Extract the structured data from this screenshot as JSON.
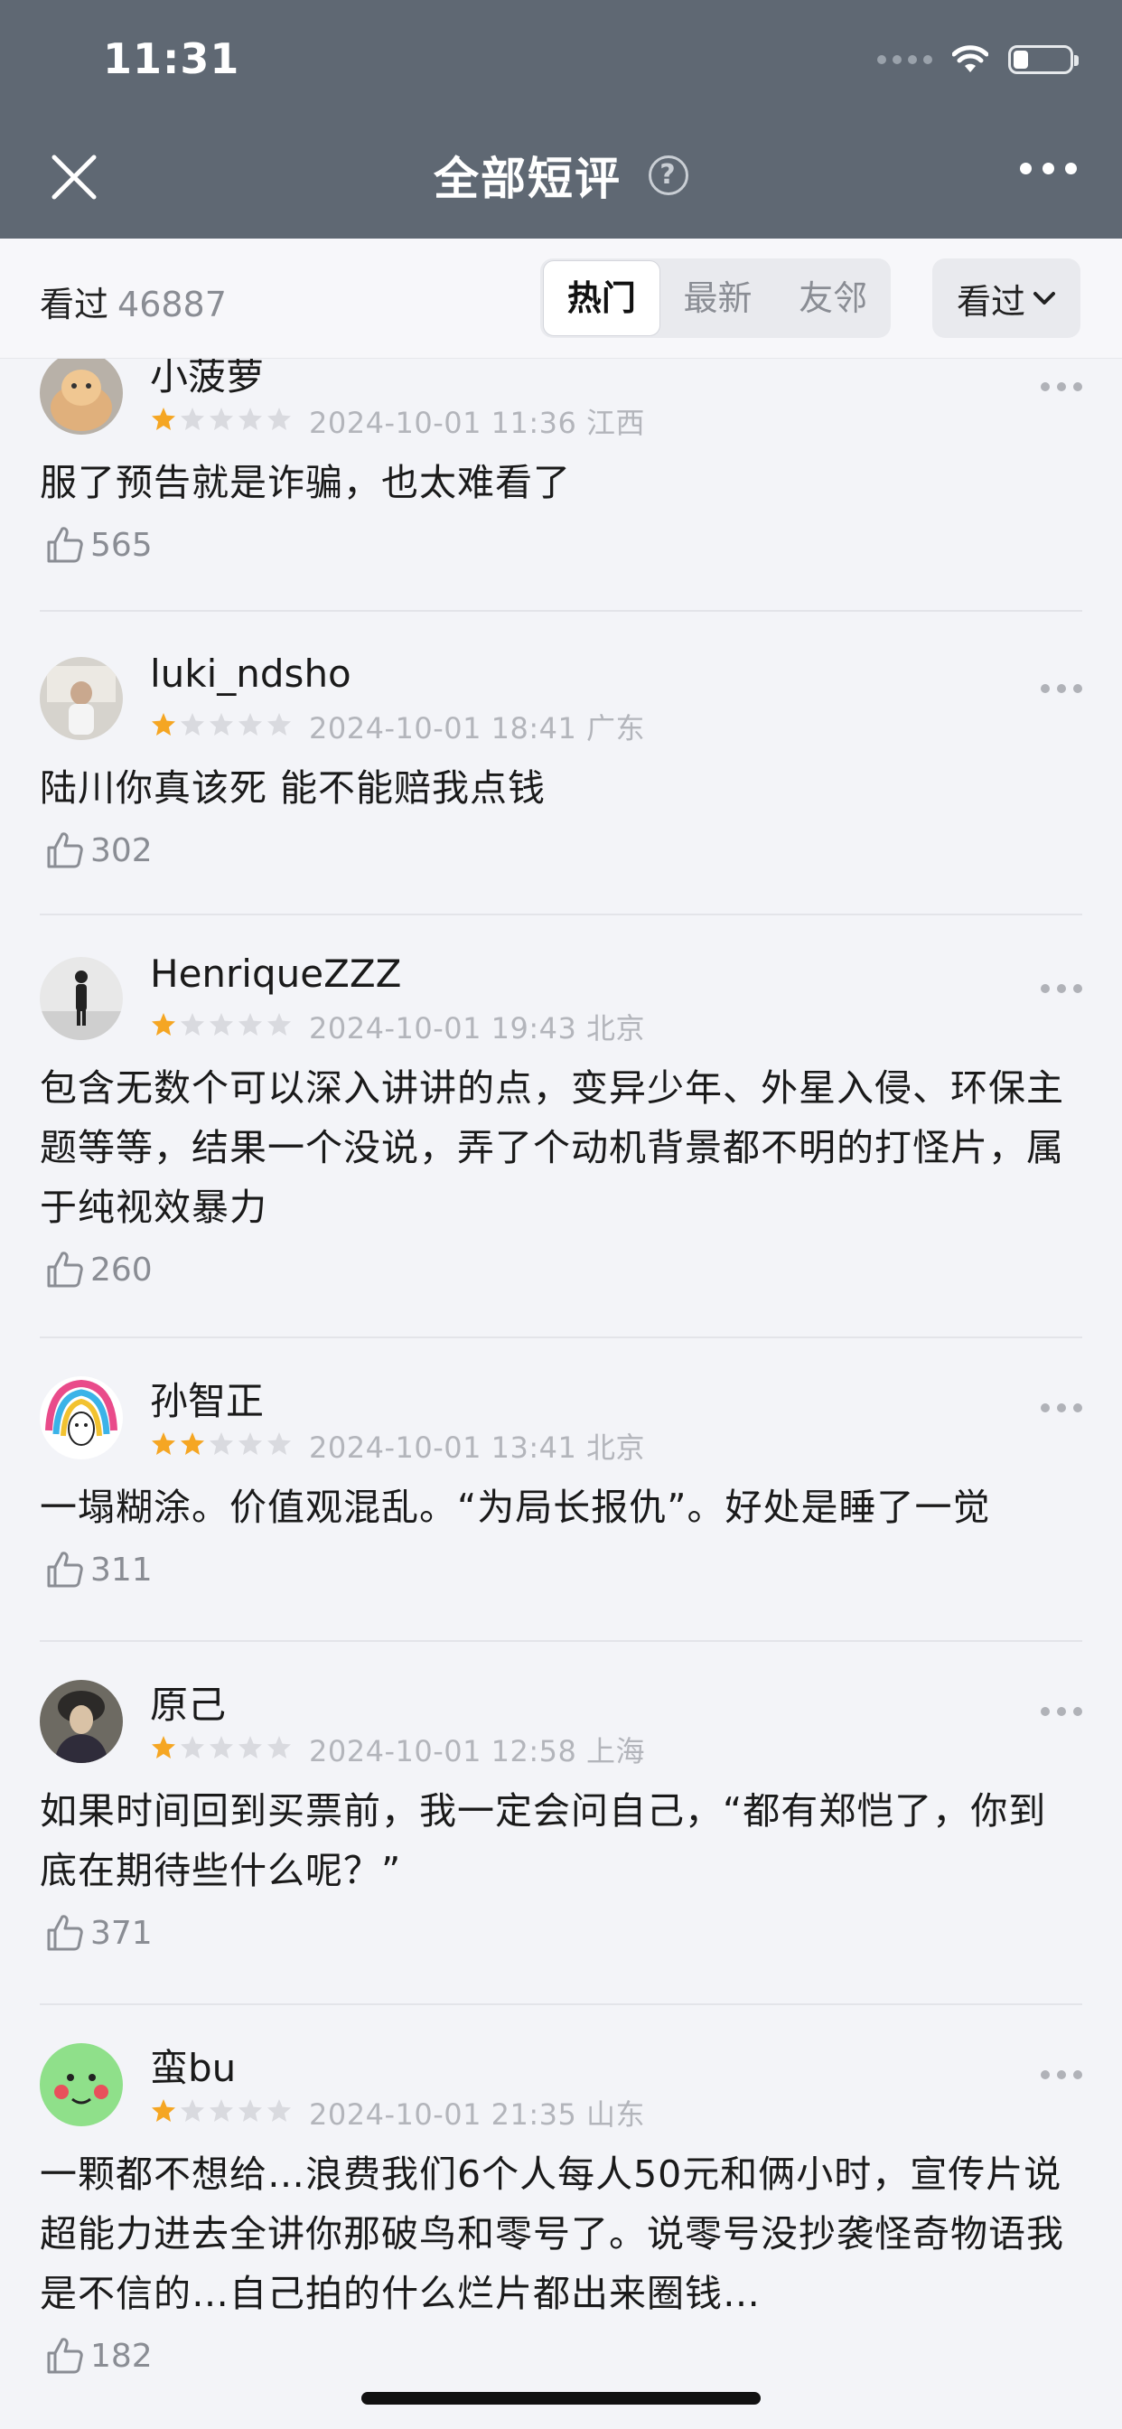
{
  "status_bar": {
    "time": "11:31"
  },
  "nav": {
    "title": "全部短评",
    "help_glyph": "?"
  },
  "filter": {
    "seen_label": "看过",
    "seen_count": "46887",
    "tabs": [
      {
        "label": "热门",
        "active": true
      },
      {
        "label": "最新",
        "active": false
      },
      {
        "label": "友邻",
        "active": false
      }
    ],
    "dropdown_label": "看过"
  },
  "reviews": [
    {
      "user": "小菠萝",
      "rating": 1,
      "time": "2024-10-01 11:36",
      "region": "江西",
      "content": "服了预告就是诈骗，也太难看了",
      "likes": "565",
      "avatar": "cat-avatar"
    },
    {
      "user": "luki_ndsho",
      "rating": 1,
      "time": "2024-10-01 18:41",
      "region": "广东",
      "content": "陆川你真该死 能不能赔我点钱",
      "likes": "302",
      "avatar": "room-avatar"
    },
    {
      "user": "HenriqueZZZ",
      "rating": 1,
      "time": "2024-10-01 19:43",
      "region": "北京",
      "content": "包含无数个可以深入讲讲的点，变异少年、外星入侵、环保主题等等，结果一个没说，弄了个动机背景都不明的打怪片，属于纯视效暴力",
      "likes": "260",
      "avatar": "silhouette-avatar"
    },
    {
      "user": "孙智正",
      "rating": 2,
      "time": "2024-10-01 13:41",
      "region": "北京",
      "content": "一塌糊涂。价值观混乱。“为局长报仇”。好处是睡了一觉",
      "likes": "311",
      "avatar": "rainbow-hair-avatar"
    },
    {
      "user": "原己",
      "rating": 1,
      "time": "2024-10-01 12:58",
      "region": "上海",
      "content": "如果时间回到买票前，我一定会问自己，“都有郑恺了，你到底在期待些什么呢？”",
      "likes": "371",
      "avatar": "portrait-avatar"
    },
    {
      "user": "蛮bu",
      "rating": 1,
      "time": "2024-10-01 21:35",
      "region": "山东",
      "content": "一颗都不想给…浪费我们6个人每人50元和俩小时，宣传片说超能力进去全讲你那破鸟和零号了。说零号没抄袭怪奇物语我是不信的…自己拍的什么烂片都出来圈钱…",
      "likes": "182",
      "avatar": "green-face-avatar"
    }
  ],
  "colors": {
    "header_bg": "#5f6873",
    "star_on": "#f5a623",
    "star_off": "#d9dadf"
  }
}
